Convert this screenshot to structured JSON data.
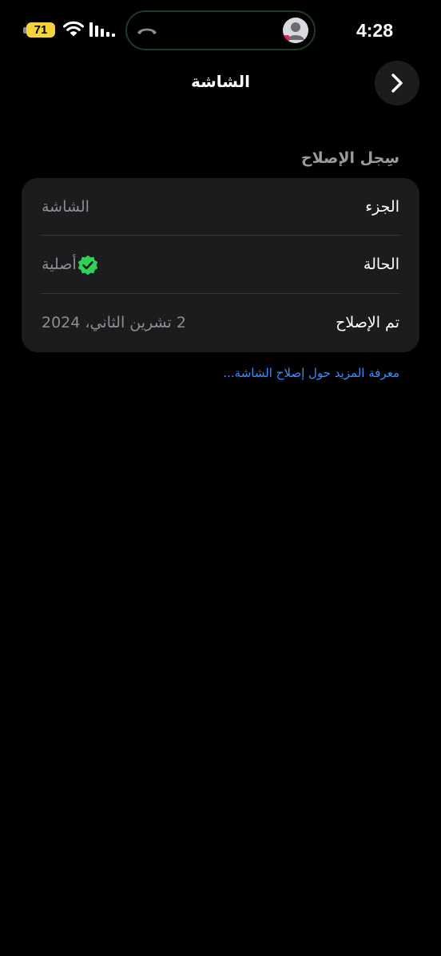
{
  "status_bar": {
    "battery_level": "71",
    "time": "4:28",
    "battery_color": "#f5d33b"
  },
  "nav": {
    "title": "الشاشة",
    "back_icon": "chevron-right-icon"
  },
  "section": {
    "header": "سِجل الإصلاح",
    "rows": [
      {
        "label": "الجزء",
        "value": "الشاشة"
      },
      {
        "label": "الحالة",
        "value": "أصلية",
        "icon": "verified-badge-icon",
        "icon_color": "#30d158"
      },
      {
        "label": "تم الإصلاح",
        "value": "2 تشرين الثاني، 2024"
      }
    ]
  },
  "link": {
    "text": "معرفة المزيد حول إصلاح الشاشة...",
    "color": "#3a8ef6"
  }
}
